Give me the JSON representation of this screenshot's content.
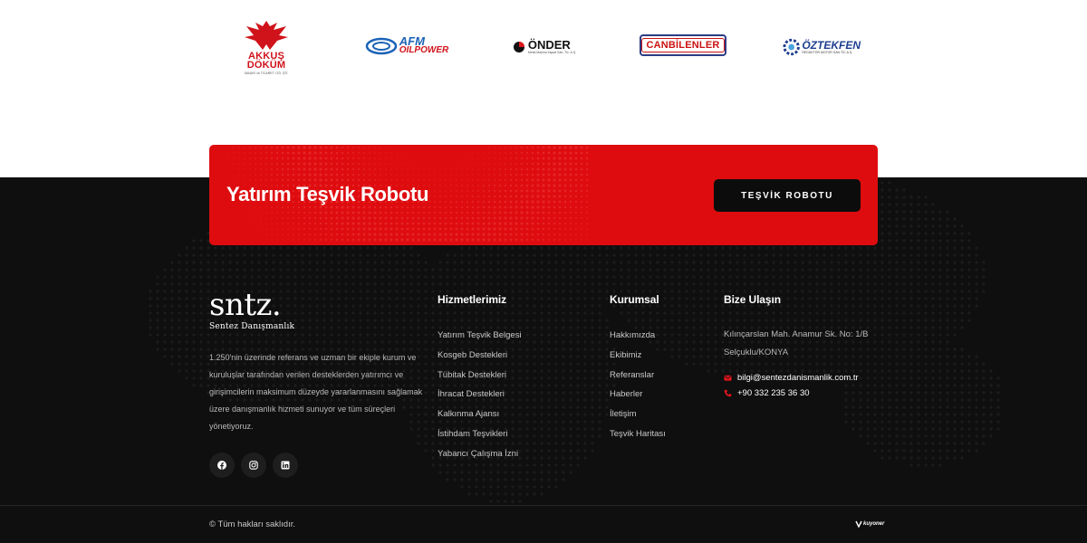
{
  "partners": {
    "akkus": {
      "name_line1": "AKKUŞ",
      "name_line2": "DÖKÜM",
      "sub": "SANAYİ ve TİCARET LTD. ŞTİ."
    },
    "afm": {
      "top": "AFM",
      "bottom": "OILPOWER"
    },
    "onder": {
      "top": "ÖNDER",
      "bottom": "Metal Makina İnşaat San. Tic. A.Ş."
    },
    "canbilenler": {
      "name": "CANBİLENLER"
    },
    "oztekfen": {
      "top": "ÖZTEKFEN",
      "bottom": "REDÜKTÖR MOTOR SAN.TİC.A.Ş."
    }
  },
  "cta": {
    "title": "Yatırım Teşvik Robotu",
    "button_label": "TEŞVİK ROBOTU",
    "color": "#de0c0f"
  },
  "brand": {
    "logo_text": "sntz.",
    "subtitle": "Sentez Danışmanlık",
    "about": "1.250'nin üzerinde referans ve uzman bir ekiple kurum ve kuruluşlar tarafından verilen desteklerden yatırımcı ve girişimcilerin maksimum düzeyde yararlanmasını sağlamak üzere danışmanlık hizmeti sunuyor ve tüm süreçleri yönetiyoruz."
  },
  "socials": [
    {
      "name": "facebook-icon"
    },
    {
      "name": "instagram-icon"
    },
    {
      "name": "linkedin-icon"
    }
  ],
  "services": {
    "title": "Hizmetlerimiz",
    "items": [
      "Yatırım Teşvik Belgesi",
      "Kosgeb Destekleri",
      "Tübitak Destekleri",
      "İhracat Destekleri",
      "Kalkınma Ajansı",
      "İstihdam Teşvikleri",
      "Yabancı Çalışma İzni"
    ]
  },
  "corporate": {
    "title": "Kurumsal",
    "items": [
      "Hakkımızda",
      "Ekibimiz",
      "Referanslar",
      "Haberler",
      "İletişim",
      "Teşvik Haritası"
    ]
  },
  "contact": {
    "title": "Bize Ulaşın",
    "address": "Kılınçarslan Mah. Anamur Sk. No: 1/B Selçuklu/KONYA",
    "email": "bilgi@sentezdanismanlik.com.tr",
    "phone": "+90 332 235 36 30",
    "icon_color": "#e0161b"
  },
  "footer": {
    "copyright": "© Tüm hakları saklıdır.",
    "agency": "kuyoner"
  }
}
